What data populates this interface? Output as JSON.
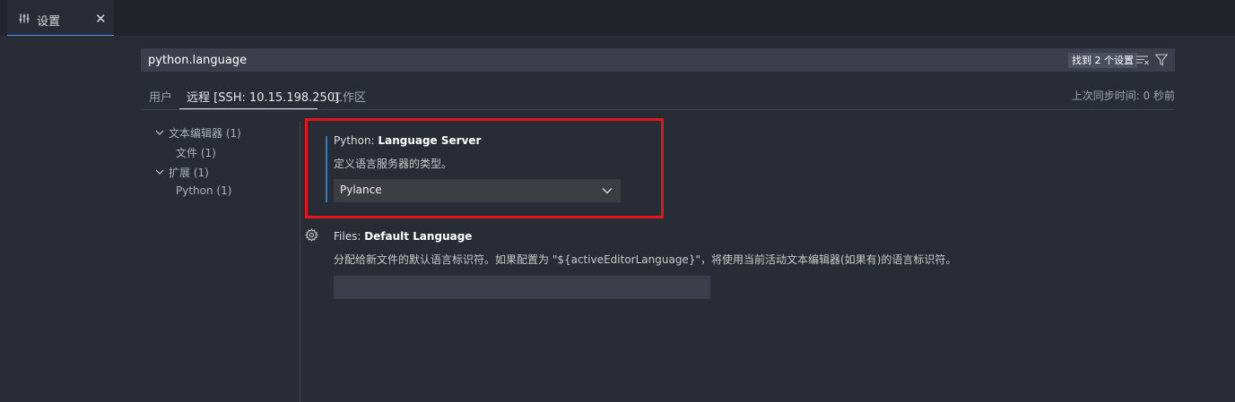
{
  "tab": {
    "label": "设置",
    "close": "✕",
    "icon": "settings-sliders-icon"
  },
  "search": {
    "value": "python.language",
    "count": "找到 2 个设置"
  },
  "scope_tabs": [
    {
      "label": "用户"
    },
    {
      "label": "远程 [SSH: 10.15.198.250]",
      "active": true
    },
    {
      "label": "工作区"
    }
  ],
  "sync_status": "上次同步时间: 0 秒前",
  "toc": [
    {
      "label": "文本编辑器 (1)",
      "expanded": true
    },
    {
      "label": "文件 (1)"
    },
    {
      "label": "扩展 (1)",
      "expanded": true
    },
    {
      "label": "Python (1)"
    }
  ],
  "settings": [
    {
      "category": "Python: ",
      "name": "Language Server",
      "description": "定义语言服务器的类型。",
      "value": "Pylance"
    },
    {
      "category": "Files: ",
      "name": "Default Language",
      "description": "分配给新文件的默认语言标识符。如果配置为 \"${activeEditorLanguage}\"，将使用当前活动文本编辑器(如果有)的语言标识符。",
      "value": ""
    }
  ],
  "colors": {
    "accent": "#528bff",
    "modified_bar": "#2f7ec4",
    "highlight_box": "#e3151a"
  }
}
